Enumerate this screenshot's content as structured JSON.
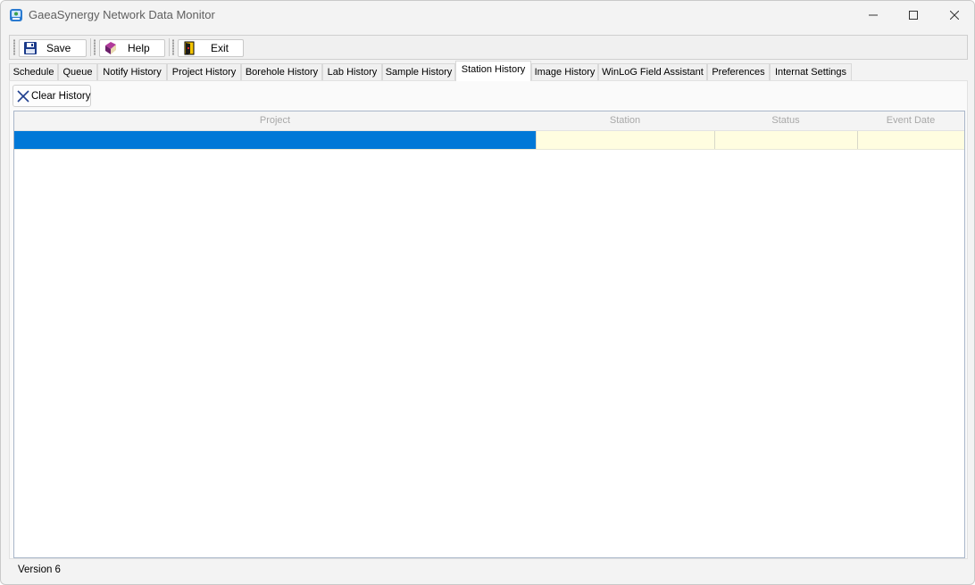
{
  "window": {
    "title": "GaeaSynergy Network Data Monitor"
  },
  "toolbar": {
    "save_label": "Save",
    "help_label": "Help",
    "exit_label": "Exit"
  },
  "tabs": [
    {
      "label": "Schedule"
    },
    {
      "label": "Queue"
    },
    {
      "label": "Notify History"
    },
    {
      "label": "Project History"
    },
    {
      "label": "Borehole History"
    },
    {
      "label": "Lab History"
    },
    {
      "label": "Sample History"
    },
    {
      "label": "Station History",
      "active": true
    },
    {
      "label": "Image History"
    },
    {
      "label": "WinLoG Field Assistant"
    },
    {
      "label": "Preferences"
    },
    {
      "label": "Internat Settings"
    }
  ],
  "panel": {
    "clear_history_label": "Clear History"
  },
  "grid": {
    "columns": [
      "Project",
      "Station",
      "Status",
      "Event Date"
    ],
    "rows": [
      [
        "",
        "",
        "",
        ""
      ]
    ]
  },
  "status": {
    "version": "Version 6"
  },
  "colors": {
    "selection": "#0078d7",
    "row_highlight": "#fffde0"
  },
  "icons": {
    "app": "network-monitor-icon",
    "save": "floppy-disk-icon",
    "help": "book-icon",
    "exit": "door-exit-icon",
    "clear": "x-icon"
  }
}
